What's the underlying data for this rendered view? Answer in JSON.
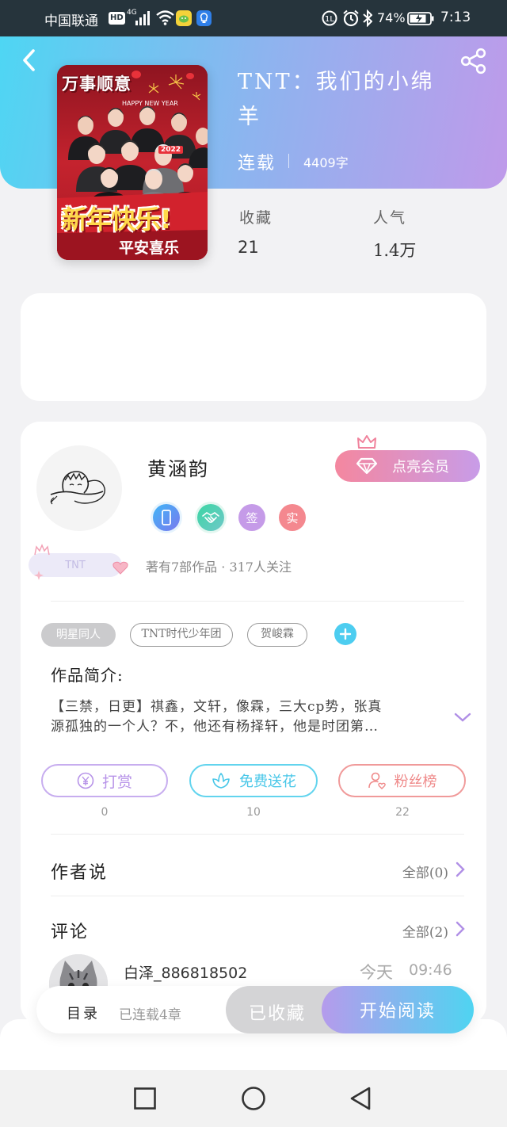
{
  "status_bar": {
    "carrier": "中国联通",
    "hd": "HD",
    "network": "4G",
    "battery_percent": "74%",
    "time": "7:13",
    "icons": [
      "signal-icon",
      "wifi-icon",
      "app-notification-icon",
      "app-notification-icon-2",
      "nfc-icon",
      "alarm-icon",
      "bluetooth-icon",
      "battery-icon"
    ]
  },
  "header": {
    "back_icon": "chevron-left-icon",
    "share_icon": "share-icon",
    "title": "TNT：我们的小绵羊",
    "status": "连载",
    "word_count": "4409字",
    "gradient": [
      "#4ed6f3",
      "#bf9aea"
    ]
  },
  "cover": {
    "top_text": "万事顺意",
    "banner_text": "HAPPY NEW YEAR",
    "year": "2022",
    "main_text": "新年快乐!",
    "bottom_text": "平安喜乐"
  },
  "stats": [
    {
      "label": "收藏",
      "value": "21"
    },
    {
      "label": "人气",
      "value": "1.4万"
    }
  ],
  "author": {
    "name": "黄涵韵",
    "member_button": "点亮会员",
    "member_icon": "crown-icon",
    "badges": [
      {
        "icon": "phone-badge-icon",
        "color": "#5b8ff2"
      },
      {
        "icon": "handshake-badge-icon",
        "color": "#5fd0b0"
      },
      {
        "label": "签",
        "color": "#c59be8"
      },
      {
        "label": "实",
        "color": "#f4888f"
      }
    ],
    "fan_badge": "TNT",
    "info": "著有7部作品 · 317人关注"
  },
  "tags": [
    "明星同人",
    "TNT时代少年团",
    "贺峻霖"
  ],
  "synopsis": {
    "heading": "作品简介:",
    "line1": "【三禁，日更】祺鑫，文轩，像霖，三大cp势，张真",
    "line2": "源孤独的一个人？不，他还有杨择轩，他是时团第…"
  },
  "actions": [
    {
      "label": "打赏",
      "count": "0",
      "icon": "yen-coin-icon",
      "color": "#b793e8"
    },
    {
      "label": "免费送花",
      "count": "10",
      "icon": "flower-icon",
      "color": "#49c7e8"
    },
    {
      "label": "粉丝榜",
      "count": "22",
      "icon": "fan-ranking-icon",
      "color": "#ef8a8a"
    }
  ],
  "author_says": {
    "title": "作者说",
    "link": "全部(0)"
  },
  "comments": {
    "title": "评论",
    "link": "全部(2)",
    "items": [
      {
        "user": "白泽_886818502",
        "day": "今天",
        "time": "09:46"
      }
    ]
  },
  "bottom_bar": {
    "toc": "目录",
    "chapters": "已连载4章",
    "collected": "已收藏",
    "start": "开始阅读"
  },
  "nav_bar": {
    "icons": [
      "recent-apps-icon",
      "home-icon",
      "back-icon"
    ]
  }
}
